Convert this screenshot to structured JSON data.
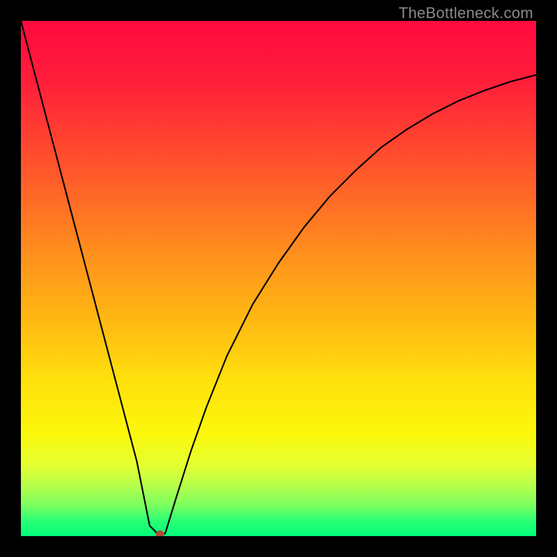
{
  "watermark": "TheBottleneck.com",
  "chart_data": {
    "type": "line",
    "title": "",
    "xlabel": "",
    "ylabel": "",
    "xlim": [
      0,
      1
    ],
    "ylim": [
      0,
      1
    ],
    "x": [
      0.0,
      0.025,
      0.05,
      0.075,
      0.1,
      0.125,
      0.15,
      0.175,
      0.2,
      0.225,
      0.25,
      0.265,
      0.28,
      0.3,
      0.33,
      0.36,
      0.4,
      0.45,
      0.5,
      0.55,
      0.6,
      0.65,
      0.7,
      0.75,
      0.8,
      0.85,
      0.9,
      0.95,
      1.0
    ],
    "values": [
      1.0,
      0.905,
      0.81,
      0.715,
      0.62,
      0.525,
      0.43,
      0.335,
      0.24,
      0.145,
      0.02,
      0.005,
      0.005,
      0.07,
      0.165,
      0.25,
      0.35,
      0.45,
      0.53,
      0.6,
      0.66,
      0.71,
      0.755,
      0.79,
      0.82,
      0.845,
      0.865,
      0.882,
      0.895
    ],
    "marker": {
      "x": 0.27,
      "y": 0.003,
      "color": "#b34a3a"
    },
    "background_gradient": [
      "#ff0a3e",
      "#ff8f1d",
      "#ffe10c",
      "#00ff7a"
    ]
  }
}
